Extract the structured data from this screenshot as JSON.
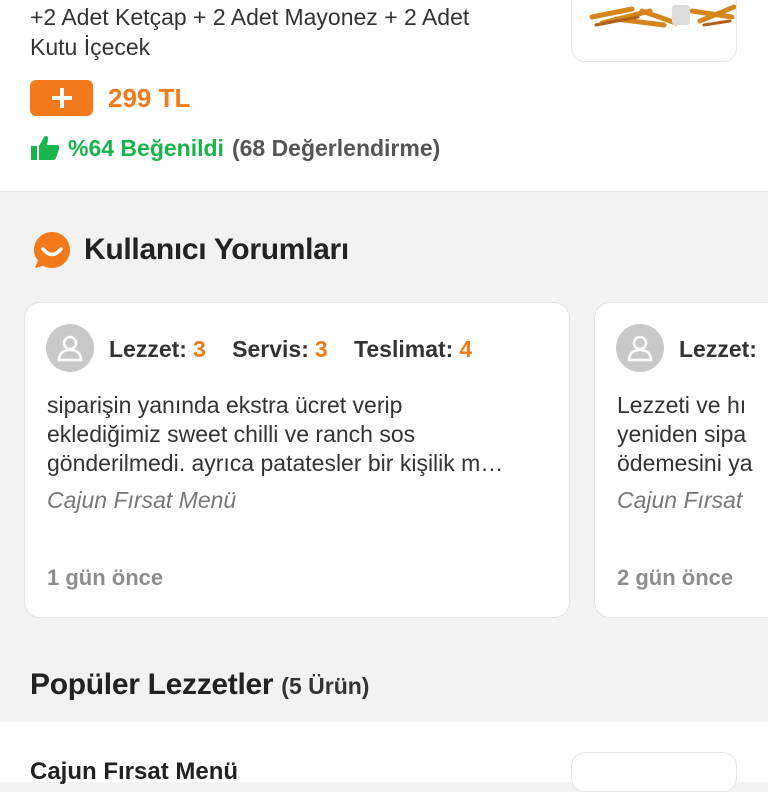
{
  "product": {
    "description_lines": [
      "+2 Adet Ketçap + 2 Adet Mayonez + 2 Adet",
      "Kutu İçecek"
    ],
    "price": "299 TL",
    "add_icon": "plus-icon",
    "liked_text": "%64 Beğenildi",
    "ratings_count": "(68 Değerlendirme)",
    "thumb_icon": "thumbs-up-icon"
  },
  "reviews_section": {
    "title": "Kullanıcı Yorumları",
    "icon": "comment-smile-icon"
  },
  "reviews": [
    {
      "scores": [
        {
          "label": "Lezzet:",
          "value": "3"
        },
        {
          "label": "Servis:",
          "value": "3"
        },
        {
          "label": "Teslimat:",
          "value": "4"
        }
      ],
      "text_lines": [
        "siparişin yanında ekstra ücret verip",
        "eklediğimiz sweet chilli ve ranch sos",
        "gönderilmedi. ayrıca patatesler bir kişilik m…"
      ],
      "menu": "Cajun Fırsat Menü",
      "time": "1 gün önce"
    },
    {
      "scores": [
        {
          "label": "Lezzet:",
          "value": ""
        }
      ],
      "text_lines": [
        "Lezzeti ve hı",
        "yeniden sipa",
        "ödemesini ya"
      ],
      "menu": "Cajun Fırsat",
      "time": "2 gün önce"
    }
  ],
  "popular": {
    "title": "Popüler Lezzetler",
    "count": "(5 Ürün)",
    "first_item": "Cajun Fırsat Menü"
  },
  "colors": {
    "accent": "#f27a1a",
    "liked": "#19b44b",
    "muted": "#8d8d8d"
  }
}
